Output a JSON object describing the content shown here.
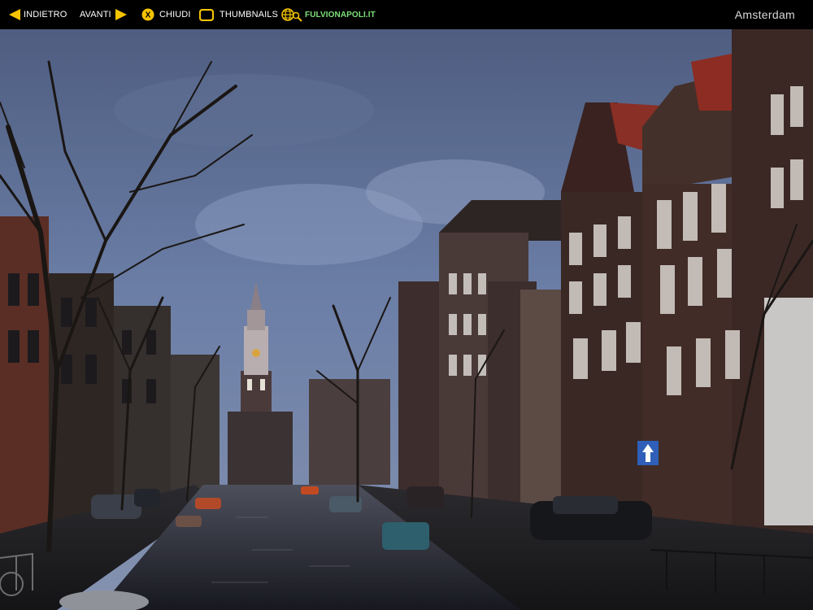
{
  "toolbar": {
    "back_label": "INDIETRO",
    "forward_label": "AVANTI",
    "close_label": "CHIUDI",
    "thumbnails_label": "THUMBNAILS",
    "site_label": "FULVIONAPOLI.IT",
    "close_icon_glyph": "X"
  },
  "gallery": {
    "title": "Amsterdam"
  },
  "icons": {
    "back": "arrow-left-icon",
    "forward": "arrow-right-icon",
    "close": "close-circle-icon",
    "thumbnails": "thumbnails-icon",
    "site": "globe-search-icon"
  },
  "colors": {
    "accent": "#f5c400",
    "site_link": "#7fe07a",
    "background": "#000000"
  }
}
